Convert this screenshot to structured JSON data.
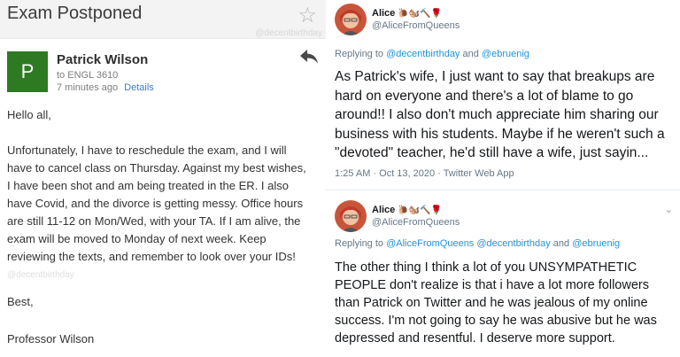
{
  "email": {
    "subject": "Exam Postponed",
    "watermark": "@decentbirthday",
    "sender_initial": "P",
    "sender_name": "Patrick Wilson",
    "to": "to ENGL 3610",
    "time": "7 minutes ago",
    "details_label": "Details",
    "greeting": "Hello all,",
    "body_lines": [
      "Unfortunately, I have to reschedule the exam, and I will",
      "have to cancel class on Thursday. Against my best wishes,",
      "I have been shot and am being treated in the ER. I also",
      "have Covid, and the divorce is getting messy. Office hours",
      "are still 11-12 on Mon/Wed, with your TA. If I am alive, the",
      "exam will be moved to Monday of next week. Keep",
      "reviewing the texts, and remember to look over your IDs!"
    ],
    "closing": "Best,",
    "signature": "Professor Wilson",
    "icons": {
      "star": "star-icon",
      "reply": "reply-icon"
    }
  },
  "tweets": [
    {
      "name": "Alice",
      "emoji": "🐌🐿️🔨🌹",
      "handle": "@AliceFromQueens",
      "replying_prefix": "Replying to",
      "replying_to": [
        "@decentbirthday",
        "@ebruenig"
      ],
      "replying_joiner": "and",
      "text": "As Patrick's wife, I just want to say that breakups are hard on everyone and there's a lot of blame to go around!! I also don't much appreciate him sharing our business with his students. Maybe if he weren't such a \"devoted\" teacher, he'd still have a wife, just sayin...",
      "meta": "1:25 AM · Oct 13, 2020 · Twitter Web App"
    },
    {
      "name": "Alice",
      "emoji": "🐌🐿️🔨🌹",
      "handle": "@AliceFromQueens",
      "replying_prefix": "Replying to",
      "replying_to": [
        "@AliceFromQueens",
        "@decentbirthday",
        "@ebruenig"
      ],
      "replying_joiner": "and",
      "text": "The other thing I think a lot of you UNSYMPATHETIC PEOPLE don't realize is that i have a lot more followers than Patrick on Twitter and he was jealous of my online success. I'm not going to say he was abusive but he was depressed and resentful. I deserve more support.",
      "chevron": "⌄"
    }
  ],
  "colors": {
    "avatar_green": "#2d7a23",
    "link_blue": "#1b95e0",
    "details_blue": "#3f79c6"
  }
}
